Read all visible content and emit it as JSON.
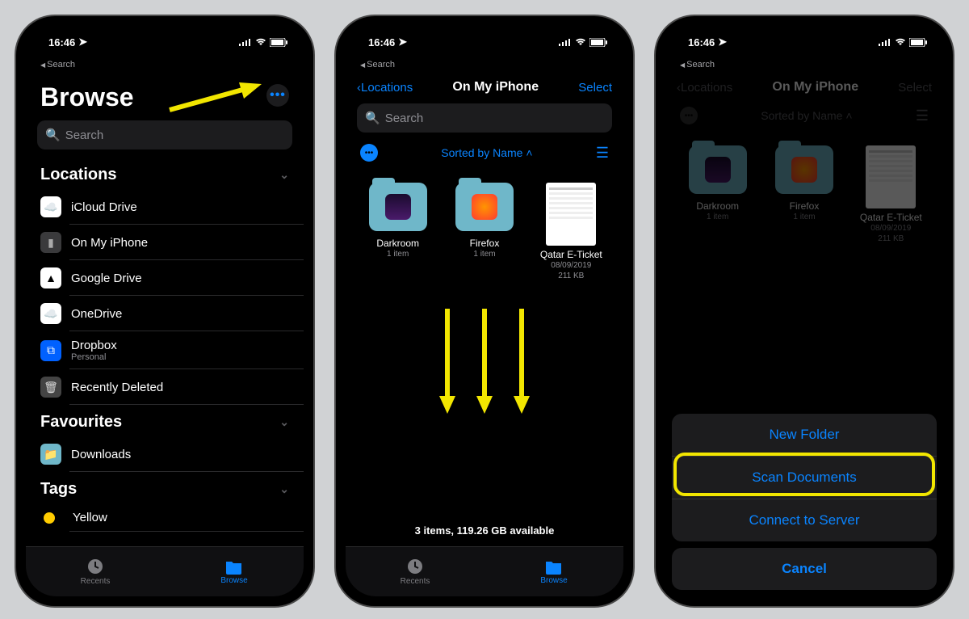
{
  "status": {
    "time": "16:46",
    "back": "Search"
  },
  "phone1": {
    "title": "Browse",
    "search_placeholder": "Search",
    "sec_locations": "Locations",
    "items": [
      {
        "label": "iCloud Drive"
      },
      {
        "label": "On My iPhone"
      },
      {
        "label": "Google Drive"
      },
      {
        "label": "OneDrive"
      },
      {
        "label": "Dropbox",
        "sub": "Personal"
      },
      {
        "label": "Recently Deleted"
      }
    ],
    "sec_favs": "Favourites",
    "fav": "Downloads",
    "sec_tags": "Tags",
    "tag": "Yellow"
  },
  "phone2": {
    "back": "Locations",
    "title": "On My iPhone",
    "select": "Select",
    "search_placeholder": "Search",
    "sort": "Sorted by Name",
    "files": [
      {
        "name": "Darkroom",
        "sub": "1 item"
      },
      {
        "name": "Firefox",
        "sub": "1 item"
      },
      {
        "name": "Qatar E-Ticket",
        "sub": "08/09/2019",
        "sub2": "211 KB"
      }
    ],
    "footer": "3 items, 119.26 GB available"
  },
  "phone3": {
    "back": "Locations",
    "title": "On My iPhone",
    "select": "Select",
    "sort": "Sorted by Name",
    "files": [
      {
        "name": "Darkroom",
        "sub": "1 item"
      },
      {
        "name": "Firefox",
        "sub": "1 item"
      },
      {
        "name": "Qatar E-Ticket",
        "sub": "08/09/2019",
        "sub2": "211 KB"
      }
    ],
    "sheet": {
      "opt1": "New Folder",
      "opt2": "Scan Documents",
      "opt3": "Connect to Server",
      "cancel": "Cancel"
    }
  },
  "tabs": {
    "recents": "Recents",
    "browse": "Browse"
  }
}
